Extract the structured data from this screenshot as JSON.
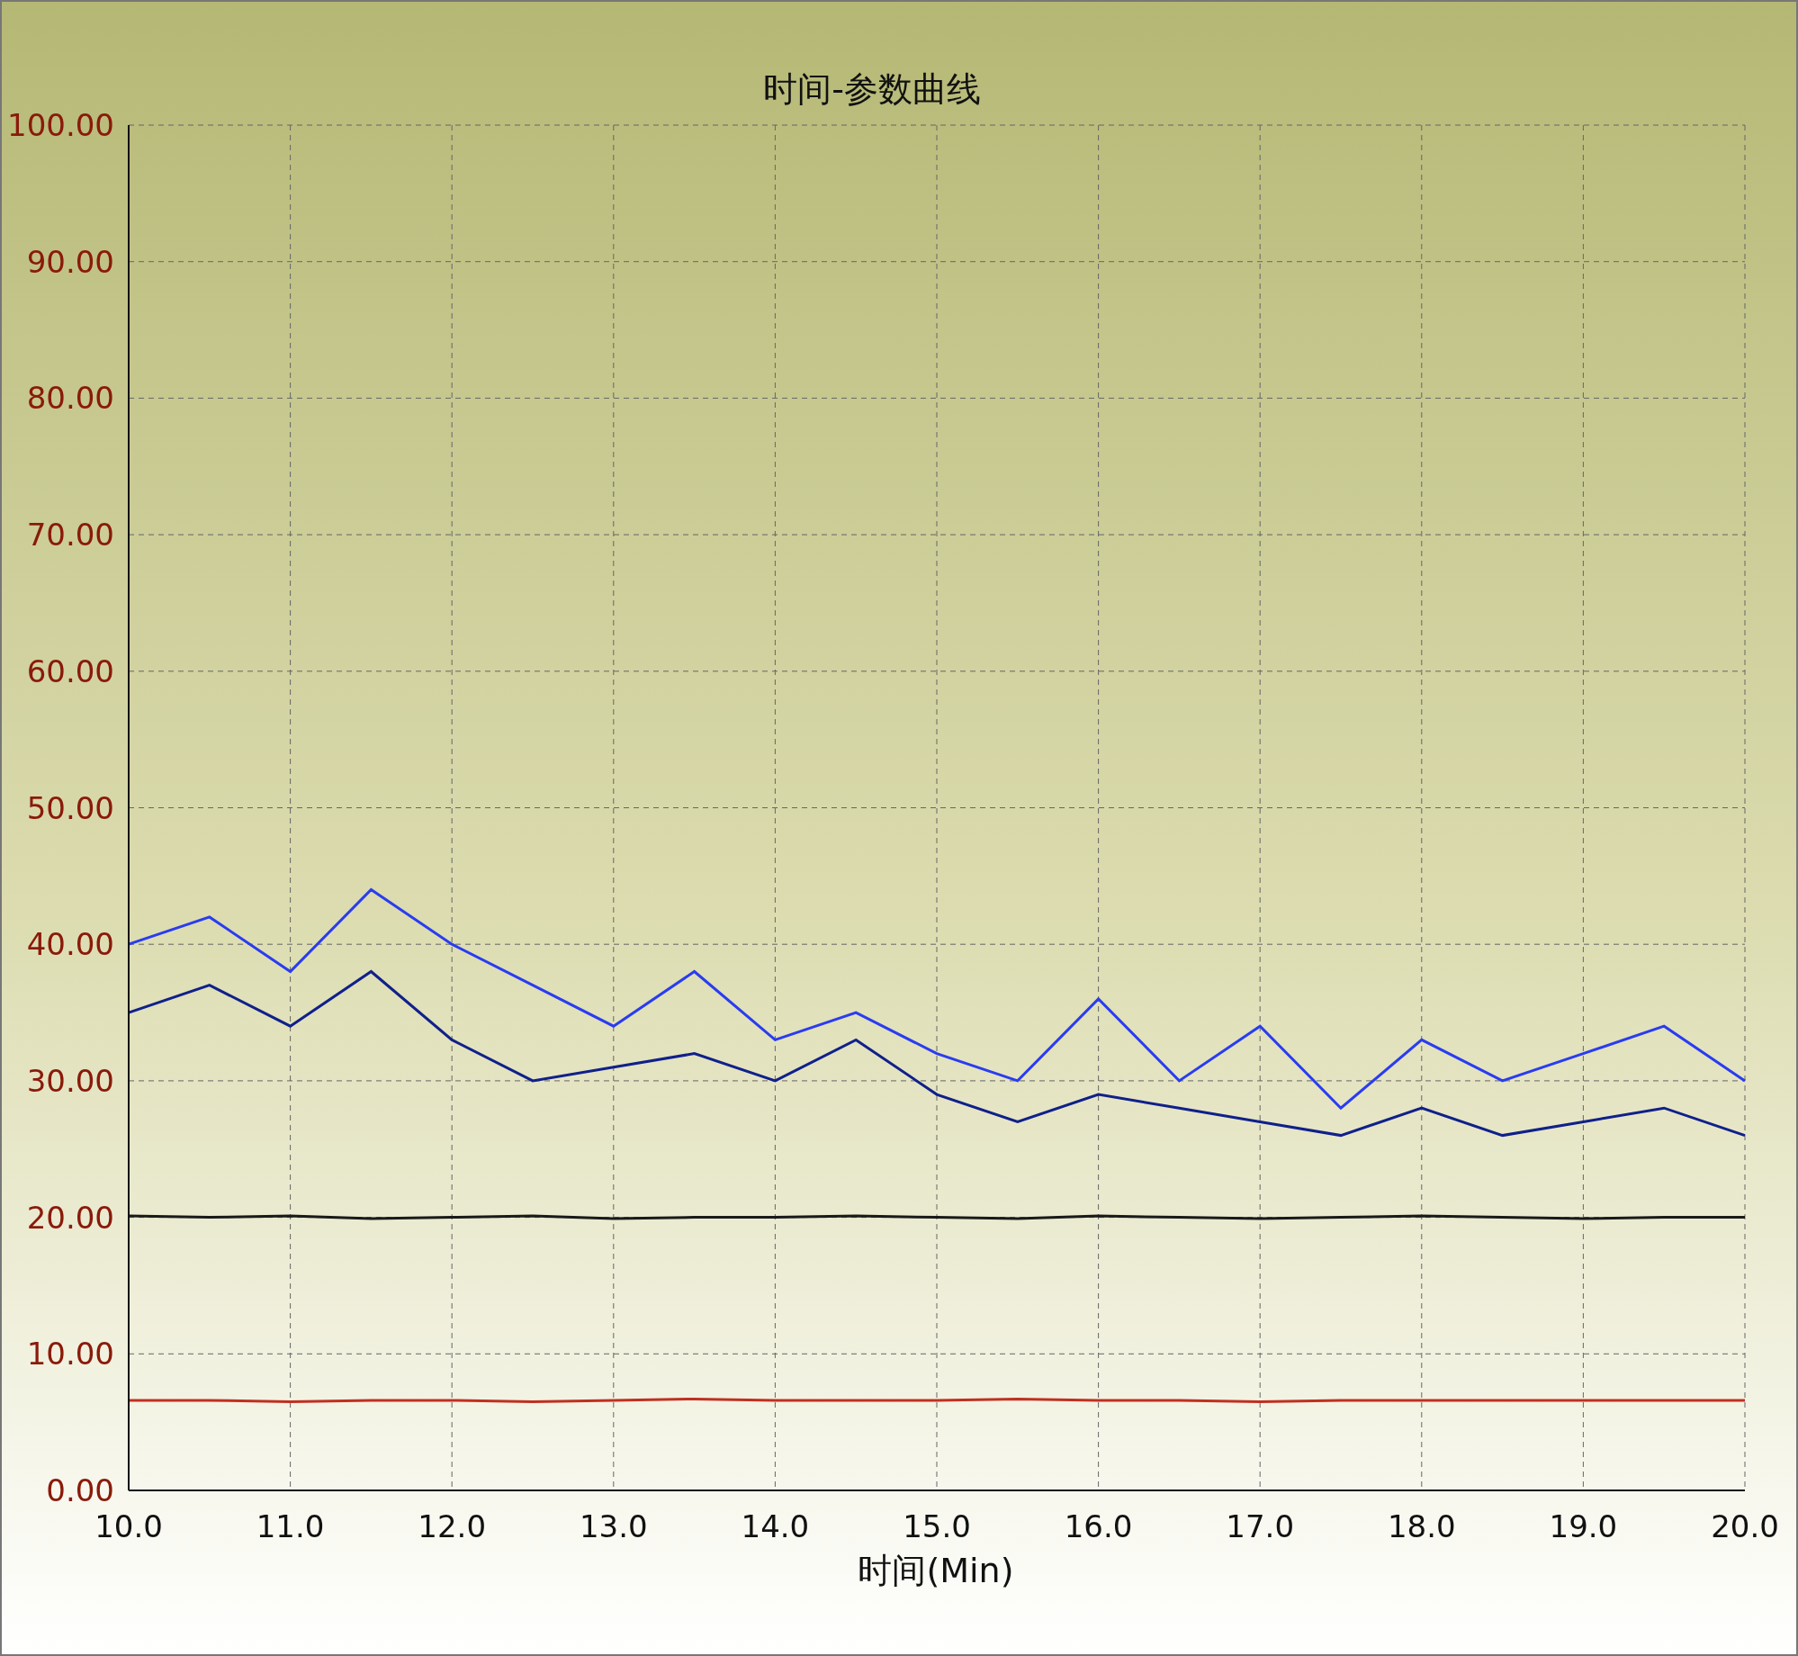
{
  "chart_data": {
    "type": "line",
    "title": "时间-参数曲线",
    "xlabel": "时间(Min)",
    "grid": true,
    "x": [
      10,
      10.5,
      11,
      11.5,
      12,
      12.5,
      13,
      13.5,
      14,
      14.5,
      15,
      15.5,
      16,
      16.5,
      17,
      17.5,
      18,
      18.5,
      19,
      19.5,
      20
    ],
    "series": [
      {
        "color": "#2a3cf0",
        "values": [
          40,
          42,
          38,
          44,
          40,
          37,
          34,
          38,
          33,
          35,
          32,
          30,
          36,
          30,
          34,
          28,
          33,
          30,
          32,
          34,
          30
        ]
      },
      {
        "color": "#10208a",
        "values": [
          35,
          37,
          34,
          38,
          33,
          30,
          31,
          32,
          30,
          33,
          29,
          27,
          29,
          28,
          27,
          26,
          28,
          26,
          27,
          28,
          26
        ]
      },
      {
        "color": "#1a1a1a",
        "values": [
          20.1,
          20,
          20.1,
          19.9,
          20,
          20.1,
          19.9,
          20,
          20,
          20.1,
          20,
          19.9,
          20.1,
          20,
          19.9,
          20,
          20.1,
          20,
          19.9,
          20,
          20
        ]
      },
      {
        "color": "#c03020",
        "values": [
          6.6,
          6.6,
          6.5,
          6.6,
          6.6,
          6.5,
          6.6,
          6.7,
          6.6,
          6.6,
          6.6,
          6.7,
          6.6,
          6.6,
          6.5,
          6.6,
          6.6,
          6.6,
          6.6,
          6.6,
          6.6
        ]
      }
    ],
    "xlim": [
      10,
      20
    ],
    "ylim": [
      0,
      100
    ],
    "xticks": [
      {
        "value": 10,
        "label": "10.0"
      },
      {
        "value": 11,
        "label": "11.0"
      },
      {
        "value": 12,
        "label": "12.0"
      },
      {
        "value": 13,
        "label": "13.0"
      },
      {
        "value": 14,
        "label": "14.0"
      },
      {
        "value": 15,
        "label": "15.0"
      },
      {
        "value": 16,
        "label": "16.0"
      },
      {
        "value": 17,
        "label": "17.0"
      },
      {
        "value": 18,
        "label": "18.0"
      },
      {
        "value": 19,
        "label": "19.0"
      },
      {
        "value": 20,
        "label": "20.0"
      }
    ],
    "yticks": [
      {
        "value": 0,
        "label": "0.00"
      },
      {
        "value": 10,
        "label": "10.00"
      },
      {
        "value": 20,
        "label": "20.00"
      },
      {
        "value": 30,
        "label": "30.00"
      },
      {
        "value": 40,
        "label": "40.00"
      },
      {
        "value": 50,
        "label": "50.00"
      },
      {
        "value": 60,
        "label": "60.00"
      },
      {
        "value": 70,
        "label": "70.00"
      },
      {
        "value": 80,
        "label": "80.00"
      },
      {
        "value": 90,
        "label": "90.00"
      },
      {
        "value": 100,
        "label": "100.00"
      }
    ]
  }
}
